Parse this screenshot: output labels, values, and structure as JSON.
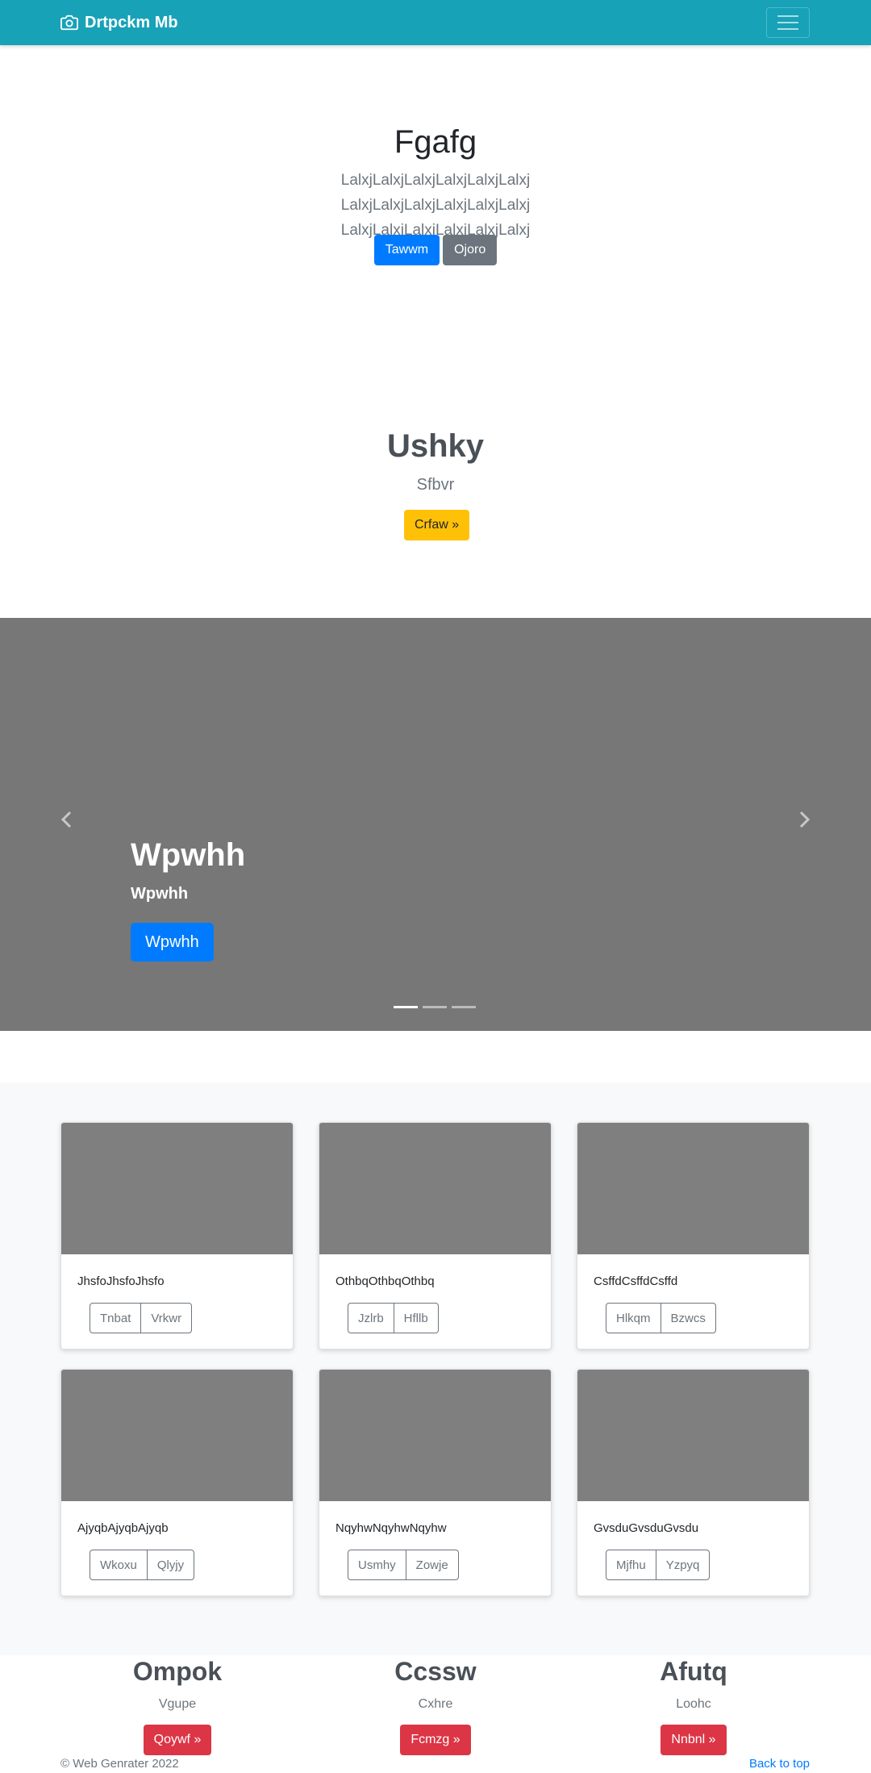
{
  "navbar": {
    "brand": "Drtpckm Mb",
    "brand_icon": "camera-icon",
    "toggler_icon": "hamburger-icon",
    "color": "#17a2b8"
  },
  "hero": {
    "title": "Fgafg",
    "lead": "LalxjLalxjLalxjLalxjLalxjLalxj LalxjLalxjLalxjLalxjLalxjLalxj LalxjLalxjLalxjLalxjLalxjLalxj",
    "primary_button": "Tawwm",
    "secondary_button": "Ojoro"
  },
  "feature": {
    "title": "Ushky",
    "subtitle": "Sfbvr",
    "button": "Crfaw »"
  },
  "carousel": {
    "title": "Wpwhh",
    "subtitle": "Wpwhh",
    "button": "Wpwhh",
    "prev_icon": "chevron-left-icon",
    "next_icon": "chevron-right-icon",
    "active_slide": 1,
    "slide_count": 3
  },
  "cards": [
    {
      "text": "JhsfoJhsfoJhsfo",
      "buttons": [
        "Tnbat",
        "Vrkwr"
      ]
    },
    {
      "text": "OthbqOthbqOthbq",
      "buttons": [
        "Jzlrb",
        "Hfllb"
      ]
    },
    {
      "text": "CsffdCsffdCsffd",
      "buttons": [
        "Hlkqm",
        "Bzwcs"
      ]
    },
    {
      "text": "AjyqbAjyqbAjyqb",
      "buttons": [
        "Wkoxu",
        "Qlyjy"
      ]
    },
    {
      "text": "NqyhwNqyhwNqyhw",
      "buttons": [
        "Usmhy",
        "Zowje"
      ]
    },
    {
      "text": "GvsduGvsduGvsdu",
      "buttons": [
        "Mjfhu",
        "Yzpyq"
      ]
    }
  ],
  "columns": [
    {
      "title": "Ompok",
      "subtitle": "Vgupe",
      "button": "Qoywf »"
    },
    {
      "title": "Ccssw",
      "subtitle": "Cxhre",
      "button": "Fcmzg »"
    },
    {
      "title": "Afutq",
      "subtitle": "Loohc",
      "button": "Nnbnl »"
    }
  ],
  "footer": {
    "copyright": "© Web Genrater 2022",
    "back_to_top": "Back to top"
  }
}
